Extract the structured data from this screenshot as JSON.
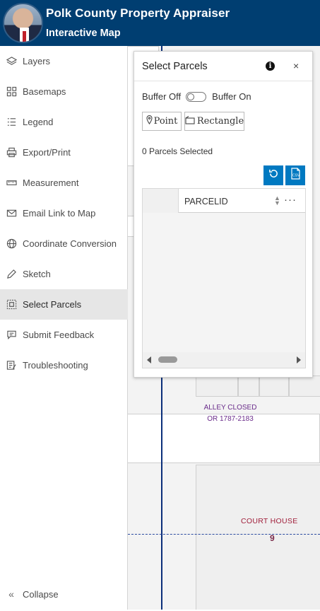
{
  "header": {
    "title": "Polk County Property Appraiser",
    "subtitle": "Interactive Map"
  },
  "sidebar": {
    "items": [
      {
        "label": "Layers",
        "icon": "layers-icon"
      },
      {
        "label": "Basemaps",
        "icon": "basemap-grid-icon"
      },
      {
        "label": "Legend",
        "icon": "legend-list-icon"
      },
      {
        "label": "Export/Print",
        "icon": "printer-icon"
      },
      {
        "label": "Measurement",
        "icon": "ruler-icon"
      },
      {
        "label": "Email Link to Map",
        "icon": "envelope-icon"
      },
      {
        "label": "Coordinate Conversion",
        "icon": "globe-icon"
      },
      {
        "label": "Sketch",
        "icon": "pencil-icon"
      },
      {
        "label": "Select Parcels",
        "icon": "select-area-icon",
        "active": true
      },
      {
        "label": "Submit Feedback",
        "icon": "chat-bubble-icon"
      },
      {
        "label": "Troubleshooting",
        "icon": "checklist-edit-icon"
      }
    ],
    "collapse_label": "Collapse",
    "collapse_glyph": "«"
  },
  "panel": {
    "title": "Select Parcels",
    "info_glyph": "i",
    "close_glyph": "×",
    "buffer_off_label": "Buffer Off",
    "buffer_on_label": "Buffer On",
    "point_label": "Point",
    "rectangle_label": "Rectangle",
    "parcels_selected": "0 Parcels Selected",
    "grid": {
      "column_header": "PARCELID",
      "more_glyph": "···"
    }
  },
  "map": {
    "labels": {
      "alley_line1": "ALLEY CLOSED",
      "alley_line2": "OR 1787-2183",
      "court_house": "COURT HOUSE",
      "court_number": "9"
    }
  },
  "colors": {
    "header_bg": "#003e71",
    "accent_button": "#0079c1",
    "active_item_bg": "#e6e6e6",
    "parcel_line": "#0b2f7a"
  }
}
